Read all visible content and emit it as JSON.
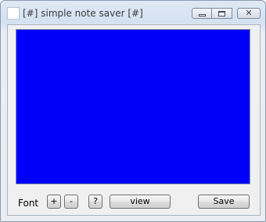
{
  "window": {
    "title": "[#] simple note saver [#]",
    "controls": {
      "minimize": "",
      "maximize": "",
      "close": "✕"
    }
  },
  "note": {
    "background_color": "#0000fa",
    "text": ""
  },
  "toolbar": {
    "font_label": "Font",
    "increase_label": "+",
    "decrease_label": "-",
    "help_label": "?",
    "view_label": "view",
    "save_label": "Save"
  }
}
